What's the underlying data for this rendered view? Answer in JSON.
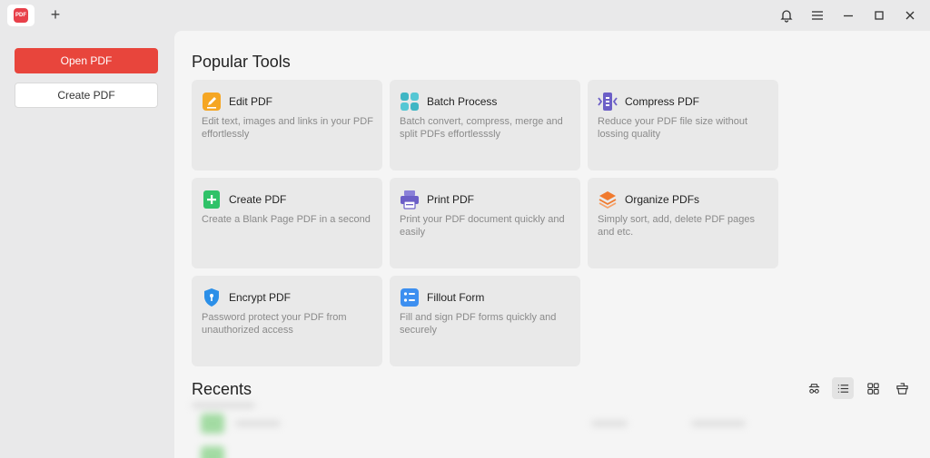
{
  "titlebar": {
    "logo_text": "PDF",
    "new_tab_symbol": "+",
    "icons": [
      "bell-icon",
      "menu-icon",
      "minimize-icon",
      "maximize-icon",
      "close-icon"
    ]
  },
  "sidebar": {
    "open_label": "Open PDF",
    "create_label": "Create PDF"
  },
  "popular": {
    "title": "Popular Tools",
    "tools": [
      {
        "title": "Edit PDF",
        "desc": "Edit text, images and links in your PDF effortlessly",
        "icon": "edit-icon",
        "color": "#f5a623"
      },
      {
        "title": "Batch Process",
        "desc": "Batch convert, compress, merge and split PDFs effortlesssly",
        "icon": "batch-icon",
        "color": "#4dbcc8"
      },
      {
        "title": "Compress PDF",
        "desc": "Reduce your PDF file size without lossing quality",
        "icon": "compress-icon",
        "color": "#6c5fc7"
      },
      {
        "title": "Create PDF",
        "desc": "Create a Blank Page PDF in a second",
        "icon": "create-icon",
        "color": "#2fc268"
      },
      {
        "title": "Print PDF",
        "desc": "Print your PDF document quickly and easily",
        "icon": "print-icon",
        "color": "#6c5fc7"
      },
      {
        "title": "Organize PDFs",
        "desc": "Simply sort, add, delete PDF pages and etc.",
        "icon": "organize-icon",
        "color": "#f07a2e"
      },
      {
        "title": "Encrypt PDF",
        "desc": "Password protect your PDF from unauthorized access",
        "icon": "shield-icon",
        "color": "#2b8fe8"
      },
      {
        "title": "Fillout Form",
        "desc": "Fill and sign PDF forms quickly and securely",
        "icon": "form-icon",
        "color": "#3d8ff0"
      }
    ]
  },
  "recents": {
    "title": "Recents",
    "view_icons": [
      "filter-icon",
      "list-view-icon",
      "grid-view-icon",
      "clear-icon"
    ],
    "active_view": "list-view-icon"
  }
}
